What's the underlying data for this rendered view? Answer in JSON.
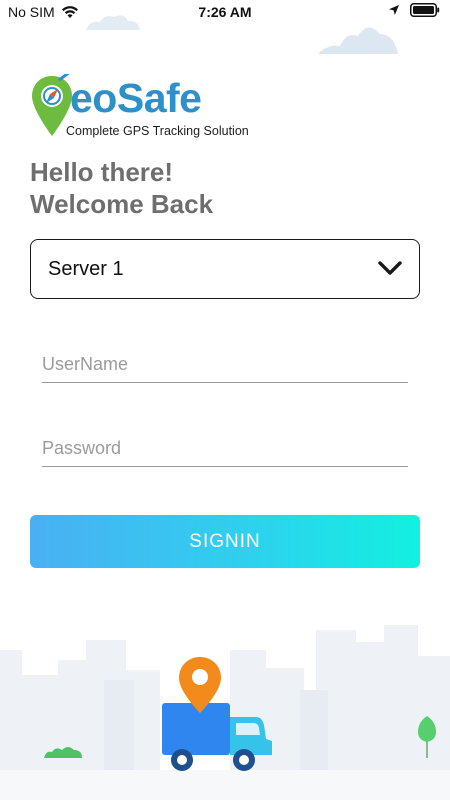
{
  "status_bar": {
    "carrier": "No SIM",
    "time": "7:26 AM"
  },
  "logo": {
    "letter_g": "G",
    "text_eo": "eo",
    "text_safe": "Safe",
    "tagline": "Complete GPS Tracking Solution"
  },
  "greeting": {
    "line1": "Hello there!",
    "line2": "Welcome Back"
  },
  "server_select": {
    "value": "Server 1",
    "icon": "chevron-down-icon"
  },
  "form": {
    "username_placeholder": "UserName",
    "password_placeholder": "Password",
    "signin_label": "SIGNIN"
  },
  "colors": {
    "brand_blue": "#2e8fc9",
    "brand_green": "#6dbb3f",
    "button_start": "#4aaff3",
    "button_end": "#12f0e0",
    "pin_orange": "#f28a1c",
    "truck_blue": "#2f86ef"
  }
}
